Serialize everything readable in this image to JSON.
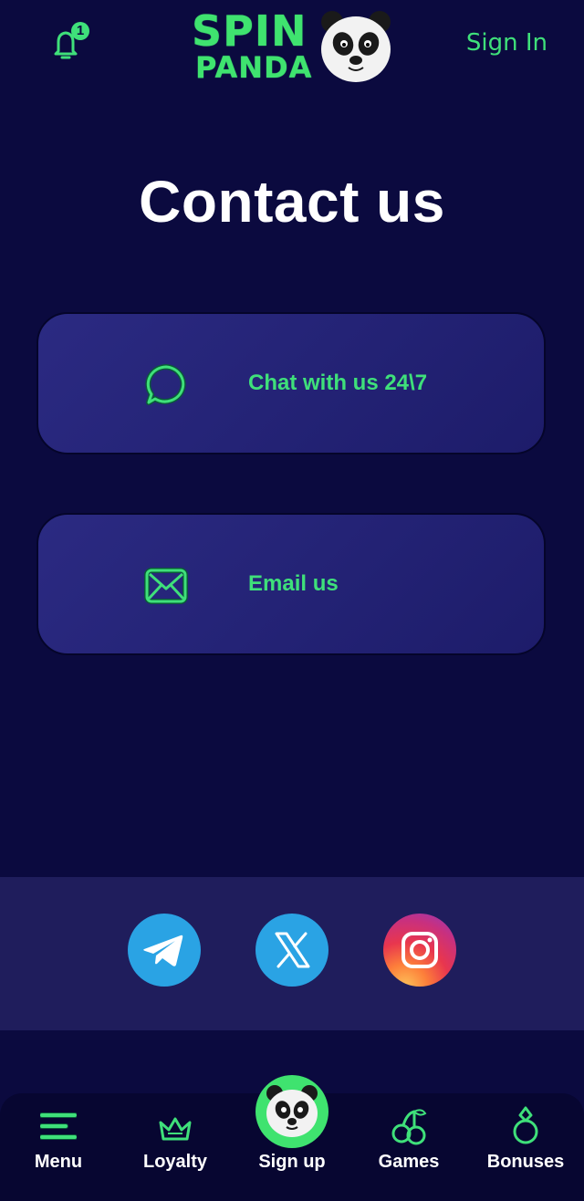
{
  "header": {
    "notification_count": "1",
    "logo_line1": "SPIN",
    "logo_line2": "PANDA",
    "signin_label": "Sign In"
  },
  "main": {
    "title": "Contact us",
    "contacts": [
      {
        "label": "Chat with us 24\\7",
        "icon": "chat-bubble-icon"
      },
      {
        "label": "Email us",
        "icon": "envelope-icon"
      }
    ]
  },
  "social": [
    {
      "name": "telegram",
      "icon": "telegram-icon"
    },
    {
      "name": "x",
      "icon": "x-icon"
    },
    {
      "name": "instagram",
      "icon": "instagram-icon"
    }
  ],
  "bottom_nav": [
    {
      "label": "Menu",
      "icon": "menu-icon"
    },
    {
      "label": "Loyalty",
      "icon": "crown-icon"
    },
    {
      "label": "Sign up",
      "icon": "panda-avatar-icon"
    },
    {
      "label": "Games",
      "icon": "cherries-icon"
    },
    {
      "label": "Bonuses",
      "icon": "ring-icon"
    }
  ],
  "colors": {
    "background": "#0b0a3f",
    "accent_green": "#3fe07a",
    "card": "#2b2a82",
    "social_strip": "#1f1d5c",
    "nav": "#070631"
  }
}
